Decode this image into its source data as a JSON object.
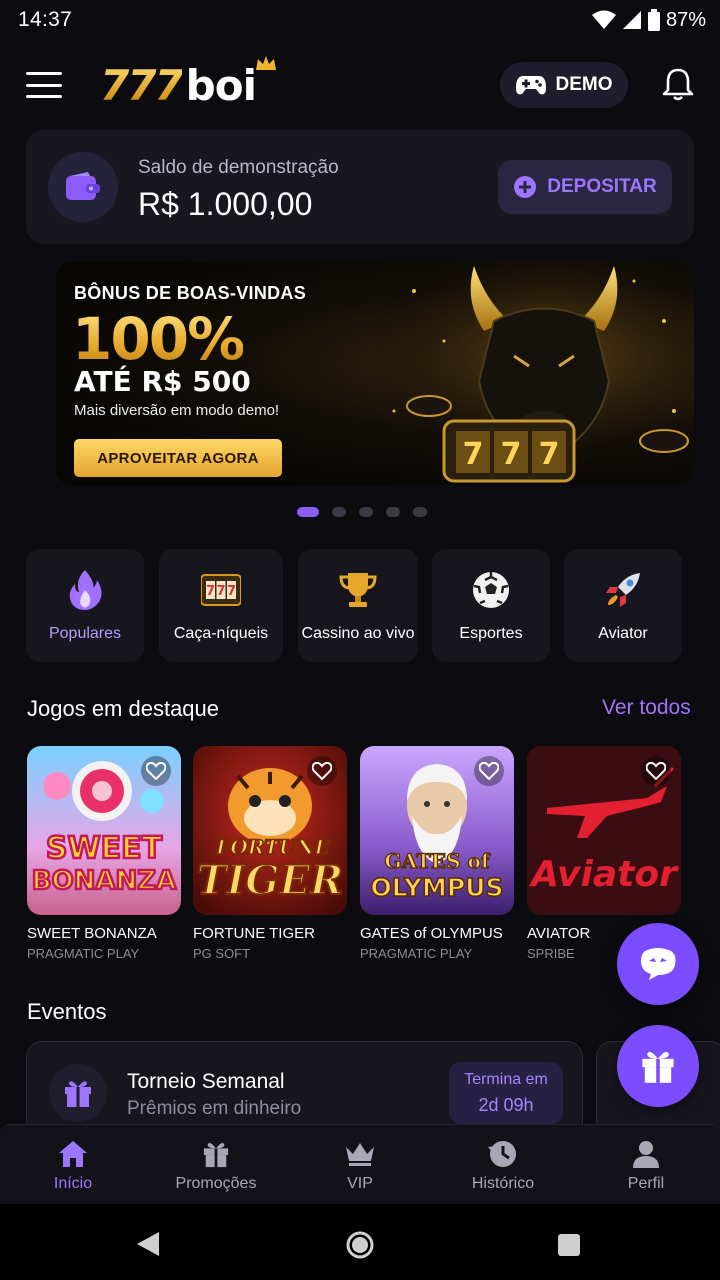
{
  "status_bar": {
    "time": "14:37",
    "battery": "87%"
  },
  "header": {
    "logo_number": "777",
    "logo_word": "boi",
    "demo_label": "DEMO"
  },
  "balance": {
    "label": "Saldo de demonstração",
    "value": "R$ 1.000,00",
    "deposit_label": "DEPOSITAR"
  },
  "banner": {
    "title": "BÔNUS DE BOAS-VINDAS",
    "big": "100%",
    "upto": "ATÉ R$ 500",
    "subtitle": "Mais diversão em modo demo!",
    "cta": "APROVEITAR AGORA",
    "slot_text": "777",
    "slides": 5,
    "active_slide": 1
  },
  "categories": [
    {
      "label": "Populares",
      "icon": "fire-icon"
    },
    {
      "label": "Caça-níqueis",
      "icon": "slot-machine-icon"
    },
    {
      "label": "Cassino ao vivo",
      "icon": "trophy-icon"
    },
    {
      "label": "Esportes",
      "icon": "soccer-ball-icon"
    },
    {
      "label": "Aviator",
      "icon": "rocket-icon"
    }
  ],
  "featured": {
    "title": "Jogos em destaque",
    "see_all": "Ver todos",
    "games": [
      {
        "name": "SWEET BONANZA",
        "provider": "PRAGMATIC PLAY",
        "art_line1": "SWEET",
        "art_line2": "BONANZA"
      },
      {
        "name": "FORTUNE TIGER",
        "provider": "PG SOFT",
        "art_line1": "FORTUNE",
        "art_line2": "TIGER"
      },
      {
        "name": "GATES of OLYMPUS",
        "provider": "PRAGMATIC PLAY",
        "art_line1": "GATES of",
        "art_line2": "OLYMPUS"
      },
      {
        "name": "AVIATOR",
        "provider": "SPRIBE",
        "art_line1": "Aviator",
        "art_line2": ""
      }
    ]
  },
  "events": {
    "title": "Eventos",
    "card": {
      "title": "Torneio Semanal",
      "subtitle": "Prêmios em dinheiro",
      "timer_label": "Termina em",
      "timer_value": "2d 09h"
    }
  },
  "bottom_nav": [
    {
      "label": "Início",
      "icon": "home-icon"
    },
    {
      "label": "Promoções",
      "icon": "gift-icon"
    },
    {
      "label": "VIP",
      "icon": "crown-icon"
    },
    {
      "label": "Histórico",
      "icon": "history-icon"
    },
    {
      "label": "Perfil",
      "icon": "user-icon"
    }
  ],
  "colors": {
    "accent": "#7c4dff",
    "accent_text": "#9d76ff",
    "gold": "#e8a82a",
    "background": "#0c0b10"
  }
}
